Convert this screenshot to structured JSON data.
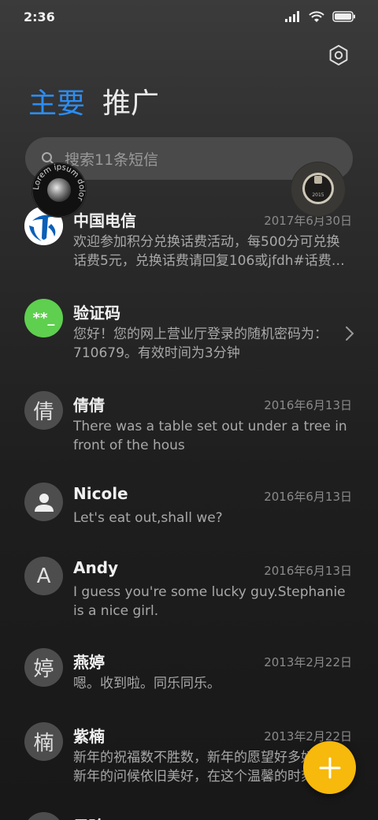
{
  "status": {
    "time": "2:36"
  },
  "tabs": [
    {
      "label": "主要",
      "active": true
    },
    {
      "label": "推广",
      "active": false
    }
  ],
  "search": {
    "placeholder": "搜索11条短信"
  },
  "float_badge": {
    "text": "Lorem ipsum dolor"
  },
  "float_icon": {
    "text": "2015"
  },
  "conversations": [
    {
      "name": "中国电信",
      "date": "2017年6月30日",
      "preview": "欢迎参加积分兑换话费活动，每500分可兑换话费5元，兑换话费请回复106或jfdh#话费…",
      "avatar": "telecom-logo"
    },
    {
      "name": "验证码",
      "date": "",
      "preview": "您好！您的网上营业厅登录的随机密码为：710679。有效时间为3分钟",
      "avatar_text": "**_",
      "avatar_color": "#5fcf4f"
    },
    {
      "name": "倩倩",
      "date": "2016年6月13日",
      "preview": "There was a table set out under a tree in front of the hous",
      "avatar_text": "倩"
    },
    {
      "name": "Nicole",
      "date": "2016年6月13日",
      "preview": "Let's eat out,shall we?",
      "avatar": "person-icon"
    },
    {
      "name": "Andy",
      "date": "2016年6月13日",
      "preview": "I guess you're some lucky guy.Stephanie is a nice girl.",
      "avatar_text": "A"
    },
    {
      "name": "燕婷",
      "date": "2013年2月22日",
      "preview": "嗯。收到啦。同乐同乐。",
      "avatar_text": "婷"
    },
    {
      "name": "紫楠",
      "date": "2013年2月22日",
      "preview": "新年的祝福数不胜数，新年的愿望好多好多，新年的问候依旧美好，在这个温馨的时刻",
      "avatar_text": "楠"
    },
    {
      "name": "子玲",
      "date": "",
      "preview": "",
      "avatar_text": ""
    }
  ],
  "colors": {
    "accent": "#2b8df2",
    "fab": "#f6b90c",
    "verify_avatar": "#5fcf4f",
    "telecom_blue": "#0b5fb7"
  }
}
